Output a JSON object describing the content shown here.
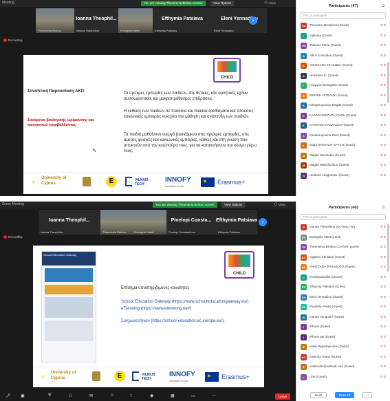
{
  "top": {
    "window_title": "Meeting",
    "share_banner": "You are viewing Theomenia Brokou screen",
    "view_options": "View Options",
    "view_label": "View",
    "recording": "Recording",
    "tiles": [
      {
        "name": "Ioanna Theophil...",
        "sub": "Ioanna Theophilou"
      },
      {
        "name": "Efthymia Patsiava",
        "sub": "Efthymia Patsiava"
      },
      {
        "name": "Eleni Yennadiou",
        "sub": "Eleni Yennadiou"
      }
    ],
    "photo_sub_labels": [
      "Theomenia Brokou",
      "Evangelia Valeti"
    ],
    "slide": {
      "title": "Συνοπτική Παρουσίαση ΑΚΠ",
      "red_text": "Συνέργεια βιολογικής ωρίμανσης και κοινωνικού περιβάλλοντος",
      "p1": "Οι πρώιμες εμπειρίες των παιδιών, είτε θετικές, είτε αρνητικές έχουν συσσωρευτικές και μακροπρόθεσμες επιδράσεις.",
      "p2": "Η έκθεση των παιδιών σε πλούσια και ποικίλα ερεθίσματα και πλούσιες κοινωνικές εμπειρίες ενισχύει την μάθηση και ανάπτυξη των παιδιών.",
      "p3": "Τα παιδιά μαθαίνουν ενεργά βασιζόμενα στις πρώιμες εμπειρίες, στις άμεσες φυσικές και κοινωνικές εμπειρίες, καθώς και στη γνώση που αποκτούν από την κουλτούρα τους, για να κατανοήσουν τον κόσμο γύρω τους.",
      "child_logo": "CHILD"
    },
    "logos": {
      "ucy": "University of Cyprus",
      "vilnius": "VILNIUS TECH",
      "innofy": "INNOFY",
      "innofy_sub": "innovation for you",
      "erasmus": "Erasmus+"
    },
    "panel": {
      "title": "Participants (47)",
      "search_placeholder": "Find a participant",
      "participants": [
        {
          "initials": "TM",
          "name": "Theodora Mavaliouti (Guest)",
          "color": "#c0392b"
        },
        {
          "initials": "I",
          "name": "Ioakimia (Guest)",
          "color": "#16a085"
        },
        {
          "initials": "TM",
          "name": "Tatsiana Maria (Guest)",
          "color": "#8e44ad"
        },
        {
          "initials": "A",
          "name": "Alkmi Kosmidou (Guest)",
          "color": "#2980b9"
        },
        {
          "initials": "A",
          "name": "ΑΝΑΣΤΑΣΙΑ ΤΣΑΚΩΝΑ (Guest)",
          "color": "#d35400"
        },
        {
          "initials": "A",
          "name": "Anastasia K. (Guest)",
          "color": "#2c3e50"
        },
        {
          "initials": "Γ",
          "name": "Γεώργιου Evangelia (Guest)",
          "color": "#27ae60"
        },
        {
          "initials": "E",
          "name": "ΕΙΡΗΝΗ ΑΓΓΕΛΙΔΗ (Guest)",
          "color": "#e67e22"
        },
        {
          "initials": "K",
          "name": "Kalogeropoulou Magda (Guest)",
          "color": "#2471a3"
        },
        {
          "initials": "K",
          "name": "ΚΑΛΛΙΚΑΝΤΖΑΡΑ ΑΓΑΠΗ (Guest)",
          "color": "#7d3c98"
        },
        {
          "initials": "K",
          "name": "ΚΑΤΕΡΙΝΑ ΚΑΒΑΛΙΔΟΥ (Guest)",
          "color": "#1f618d"
        },
        {
          "initials": "K",
          "name": "Kavalaropoulou Eleni (Guest)",
          "color": "#884ea0"
        },
        {
          "initials": "K",
          "name": "ΚΩΣΤΟΠΟΥΛΟΥ ΧΡΥΣΗ (Guest)",
          "color": "#ca6f1e"
        },
        {
          "initials": "M",
          "name": "Magda Mavraidou (Guest)",
          "color": "#b9770e"
        },
        {
          "initials": "M",
          "name": "Magda Mitsiyfunidou (Guest)",
          "color": "#a04000"
        },
        {
          "initials": "N",
          "name": "Nektaria Anagnostou (Guest)",
          "color": "#5b2c6f"
        }
      ]
    }
  },
  "bottom": {
    "window_title": "Zoom Meeting",
    "share_banner": "You are viewing Theomenia Brokou screen",
    "view_options": "View Options",
    "view_label": "View",
    "recording": "Recording",
    "tiles": [
      {
        "name": "Ioanna Theophil...",
        "sub": "Ioanna Theophilou"
      },
      {
        "name": "Pinelopi Consta...",
        "sub": "Pinelopi Constantinou"
      },
      {
        "name": "Efthymia Patsiava",
        "sub": "Efthymia Patsiava"
      }
    ],
    "photo_sub_labels": [
      "Theomenia Brokou",
      "Evangelia Valeti"
    ],
    "slide": {
      "heading": "Επίσημα υποστηριζόμενες κοινότητες",
      "line1": "School Education Gateway (https://www.schooleducationgateway.eu/)",
      "line2": "eTwinning (https://www.etwinning.net/)",
      "line3": "Συγχωνεύτηκαν (https://school-education.ec.europa.eu/).",
      "child_logo": "CHILD",
      "thumb_title": "School Education Gateway"
    },
    "logos": {
      "ucy": "University of Cyprus",
      "vilnius": "VILNIUS TECH",
      "innofy": "INNOFY",
      "innofy_sub": "innovation for you",
      "erasmus": "Erasmus+"
    },
    "panel": {
      "title": "Participants (46)",
      "search_placeholder": "Find a participant",
      "participants": [
        {
          "initials": "IT",
          "name": "Ioanna Theophilou (Co-host, me)",
          "color": "#c0392b"
        },
        {
          "initials": "EV",
          "name": "Evangelia Valeti (Host)",
          "color": "#7f8c8d"
        },
        {
          "initials": "TB",
          "name": "Theomenia Brokou (Co-host, guest)",
          "color": "#8e44ad"
        },
        {
          "initials": "AC",
          "name": "Aggelos Christina (Guest)",
          "color": "#d35400"
        },
        {
          "initials": "AP",
          "name": "ΑΝΑΣΤΑΣΙΑ ΡΑΠΑΚΟΖΙΑ (Guest)",
          "color": "#e67e22"
        },
        {
          "initials": "C",
          "name": "christinavasiliou (Guest)",
          "color": "#16a085"
        },
        {
          "initials": "EP",
          "name": "Efthymia Patsiava (Guest)",
          "color": "#27ae60"
        },
        {
          "initials": "EY",
          "name": "Eleni Yennadiou (Guest)",
          "color": "#2980b9"
        },
        {
          "initials": "EF",
          "name": "Evanthia Fenerj (Guest)",
          "color": "#1abc9c"
        },
        {
          "initials": "IS",
          "name": "Ioanna Syngouni (Guest)",
          "color": "#2471a3"
        },
        {
          "initials": "I",
          "name": "iPhone (Guest)",
          "color": "#7d3c98"
        },
        {
          "initials": "I",
          "name": "iPhone.pw (Guest)",
          "color": "#5b2c6f"
        },
        {
          "initials": "IP",
          "name": "Isaak Papadopoulos (Guest)",
          "color": "#b9770e"
        },
        {
          "initials": "KG",
          "name": "Katerina Giana (Guest)",
          "color": "#c0392b"
        },
        {
          "initials": "K",
          "name": "koutloudis@outlook.com (Guest)",
          "color": "#ca6f1e"
        },
        {
          "initials": "L",
          "name": "Lina (Guest)",
          "color": "#884ea0"
        }
      ],
      "invite_label": "Invite",
      "mute_all_label": "Mute All"
    },
    "toolbar": {
      "leave_label": "Leave"
    }
  }
}
